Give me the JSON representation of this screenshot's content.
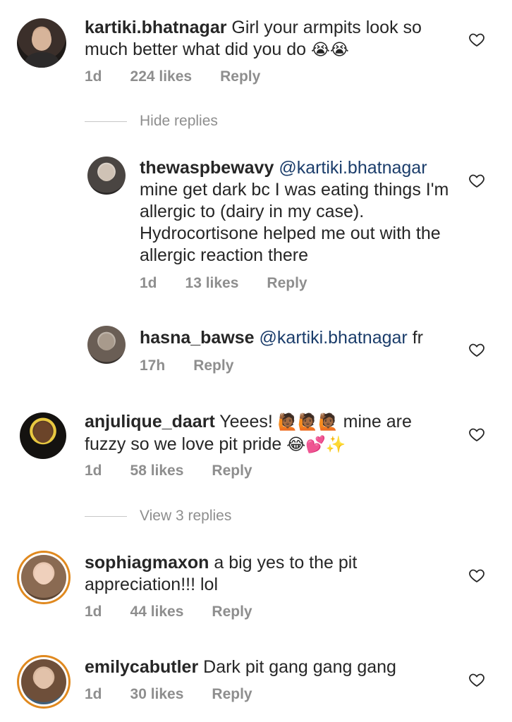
{
  "comments": [
    {
      "username": "kartiki.bhatnagar",
      "text": "Girl your armpits look so much better what did you do",
      "emojis": "😭😭",
      "time": "1d",
      "likes": "224 likes",
      "reply": "Reply",
      "toggle": "Hide replies",
      "replies": [
        {
          "username": "thewaspbewavy",
          "mention": "@kartiki.bhatnagar",
          "text": "mine get dark bc I was eating things I'm allergic to (dairy in my case). Hydrocortisone helped me out with the allergic reaction there",
          "time": "1d",
          "likes": "13 likes",
          "reply": "Reply"
        },
        {
          "username": "hasna_bawse",
          "mention": "@kartiki.bhatnagar",
          "text": "fr",
          "time": "17h",
          "reply": "Reply"
        }
      ]
    },
    {
      "username": "anjulique_daart",
      "text_a": "Yeees!",
      "emojis_a": "🙋🏾🙋🏾🙋🏾",
      "text_b": "mine are fuzzy so we love pit pride",
      "emojis_b": "😂💕✨",
      "time": "1d",
      "likes": "58 likes",
      "reply": "Reply",
      "toggle": "View 3 replies"
    },
    {
      "username": "sophiagmaxon",
      "text": "a big yes to the pit appreciation!!! lol",
      "time": "1d",
      "likes": "44 likes",
      "reply": "Reply"
    },
    {
      "username": "emilycabutler",
      "text": "Dark pit gang gang gang",
      "time": "1d",
      "likes": "30 likes",
      "reply": "Reply"
    }
  ],
  "icons": {
    "like": "heart-outline-icon"
  },
  "colors": {
    "mention": "#1b3d6b",
    "meta": "#8e8e8e",
    "story_ring": "#e0891f"
  }
}
